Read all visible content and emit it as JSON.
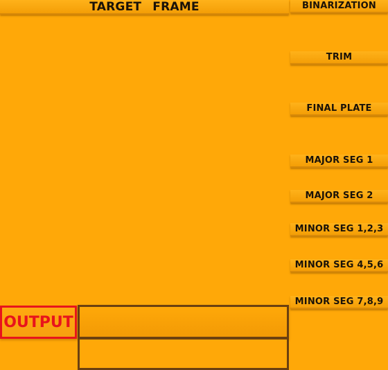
{
  "header": {
    "title": "TARGET  FRAME"
  },
  "buttons": [
    {
      "label": "BINARIZATION"
    },
    {
      "label": "TRIM"
    },
    {
      "label": "FINAL PLATE"
    },
    {
      "label": "MAJOR SEG 1"
    },
    {
      "label": "MAJOR SEG 2"
    },
    {
      "label": "MINOR SEG 1,2,3"
    },
    {
      "label": "MINOR SEG 4,5,6"
    },
    {
      "label": "MINOR SEG 7,8,9"
    }
  ],
  "output": {
    "label": "OUTPUT",
    "primary_value": "",
    "secondary_value": ""
  },
  "colors": {
    "background": "#FFA808",
    "output_label_border": "#E8141C",
    "output_box_border": "#6B4010",
    "text": "#1a1208"
  }
}
